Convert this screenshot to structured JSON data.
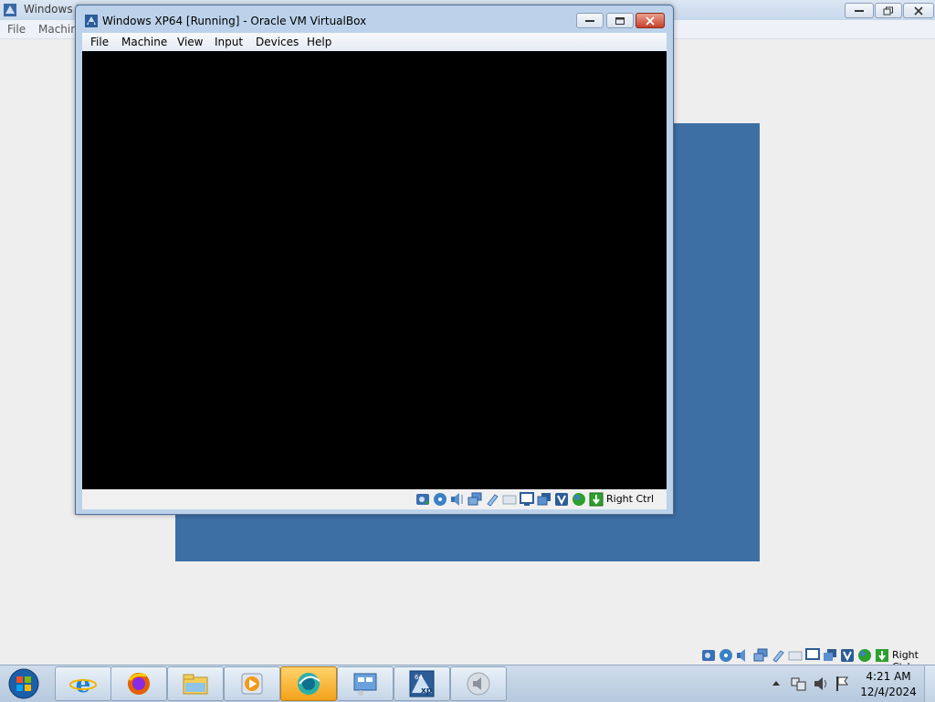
{
  "background_window": {
    "title": "Windows X",
    "menu": [
      "File",
      "Machin"
    ]
  },
  "foreground_window": {
    "title": "Windows XP64 [Running] - Oracle VM VirtualBox",
    "menu": [
      "File",
      "Machine",
      "View",
      "Input",
      "Devices",
      "Help"
    ],
    "status_icons": [
      "hard-disk-icon",
      "optical-drive-icon",
      "audio-icon",
      "network-icon",
      "usb-icon",
      "shared-folders-icon",
      "display-icon",
      "video-capture-icon",
      "virtualization-icon",
      "mouse-integration-icon",
      "keyboard-icon"
    ],
    "host_key": "Right Ctrl"
  },
  "host_status": {
    "host_key": "Right Ctrl"
  },
  "taskbar": {
    "apps": [
      {
        "name": "internet-explorer",
        "active": false
      },
      {
        "name": "firefox",
        "active": false
      },
      {
        "name": "file-explorer",
        "active": false
      },
      {
        "name": "media-player",
        "active": false
      },
      {
        "name": "virtualbox-manager",
        "active": true
      },
      {
        "name": "remote-desktop",
        "active": false
      },
      {
        "name": "windows-xp64-vm",
        "active": false
      },
      {
        "name": "audio-app",
        "active": false
      }
    ],
    "clock_time": "4:21 AM",
    "clock_date": "12/4/2024"
  },
  "colors": {
    "guest_blue": "#3d6fa5",
    "vm_screen": "#000000",
    "active_taskbar": "#f3a21b"
  }
}
